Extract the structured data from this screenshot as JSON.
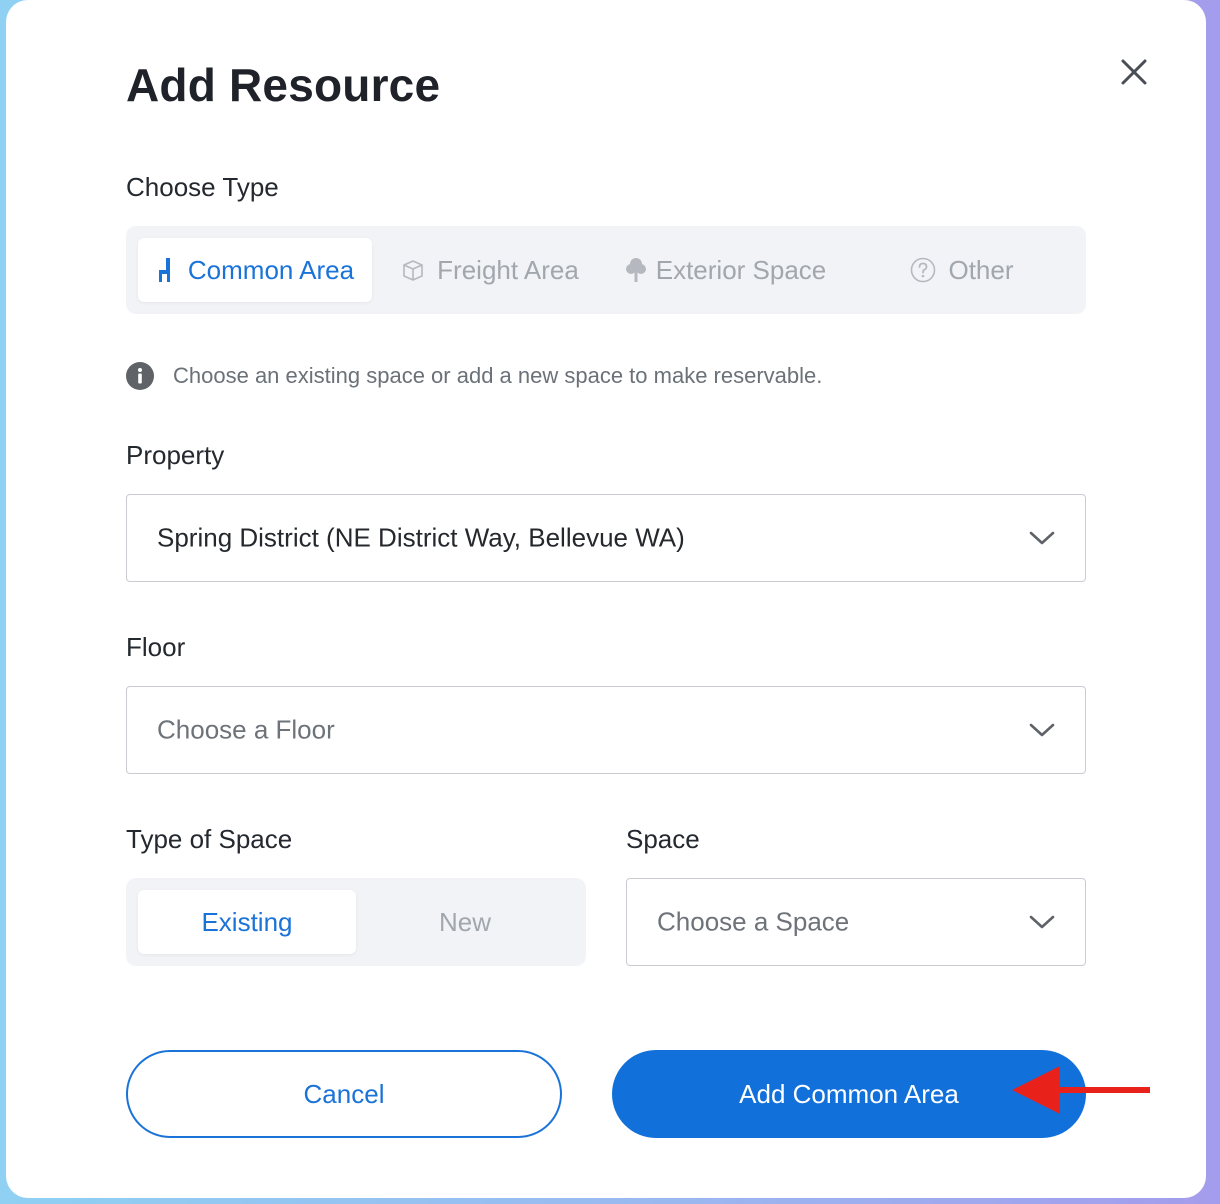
{
  "dialog": {
    "title": "Add Resource",
    "close_icon": "close-icon"
  },
  "choose_type": {
    "label": "Choose Type",
    "options": [
      {
        "label": "Common Area",
        "icon": "chair-icon",
        "selected": true
      },
      {
        "label": "Freight Area",
        "icon": "box-icon",
        "selected": false
      },
      {
        "label": "Exterior Space",
        "icon": "tree-icon",
        "selected": false
      },
      {
        "label": "Other",
        "icon": "question-icon",
        "selected": false
      }
    ]
  },
  "info": {
    "icon": "info-icon",
    "text": "Choose an existing space or add a new space to make reservable."
  },
  "property": {
    "label": "Property",
    "value": "Spring District (NE District Way, Bellevue WA)"
  },
  "floor": {
    "label": "Floor",
    "placeholder": "Choose a Floor"
  },
  "type_of_space": {
    "label": "Type of Space",
    "options": [
      {
        "label": "Existing",
        "selected": true
      },
      {
        "label": "New",
        "selected": false
      }
    ]
  },
  "space": {
    "label": "Space",
    "placeholder": "Choose a Space"
  },
  "actions": {
    "cancel_label": "Cancel",
    "primary_label": "Add Common Area"
  },
  "colors": {
    "accent": "#1a73d9",
    "primary_button": "#1270db",
    "annotation_arrow": "#e8211a"
  }
}
